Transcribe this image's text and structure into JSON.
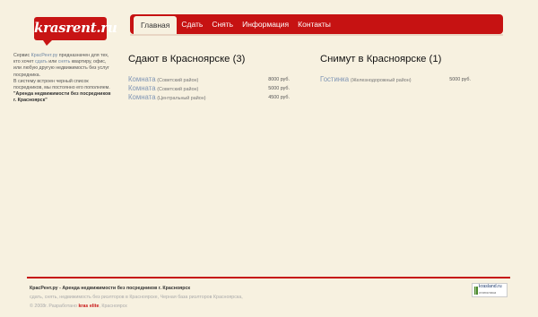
{
  "header": {
    "logo_text": "krasrent.ru",
    "nav": [
      {
        "label": "Главная",
        "active": true
      },
      {
        "label": "Сдать",
        "active": false
      },
      {
        "label": "Снять",
        "active": false
      },
      {
        "label": "Информация",
        "active": false
      },
      {
        "label": "Контакты",
        "active": false
      }
    ]
  },
  "sidebar": {
    "t1": "Сервис ",
    "brand_link": "КрасРент.ру",
    "t2": " предназначен для тех, кто хочет ",
    "sdat_link": "сдать",
    "t3": " или ",
    "snyat_link": "снять",
    "t4": " квартиру, офис, или любую другую недвижимость без услуг посредника.",
    "t5": "В систему встроен черный список посредников, мы постоянно его пополняем.",
    "slogan": "\"Аренда недвижимости без посредников г. Красноярск\""
  },
  "offers": {
    "title": "Сдают в Красноярске (3)",
    "rows": [
      {
        "name": "Комната",
        "district": "(Советский район)",
        "price": "8000 руб."
      },
      {
        "name": "Комната",
        "district": "(Советский район)",
        "price": "5000 руб."
      },
      {
        "name": "Комната",
        "district": "(Центральный район)",
        "price": "4500 руб."
      }
    ]
  },
  "requests": {
    "title": "Снимут в Красноярске (1)",
    "rows": [
      {
        "name": "Гостинка",
        "district": "(Железнодорожный район)",
        "price": "5000 руб."
      }
    ]
  },
  "footer": {
    "line1": "КрасРент.ру - Аренда недвижимости без посредников г. Красноярск",
    "line2": "сдать, снять, недвижимость без риэлторов в Красноярске, Черная база риэлторов Красноярска,",
    "line3_prefix": "© 2008г. Разработано ",
    "elite": "kras elite",
    "line3_suffix": ", Красноярск"
  },
  "badge": {
    "title": "krasland.ru",
    "subtitle": "статистика"
  },
  "colors": {
    "accent": "#c61212",
    "background": "#f7f1e0",
    "link": "#7f95b5"
  }
}
